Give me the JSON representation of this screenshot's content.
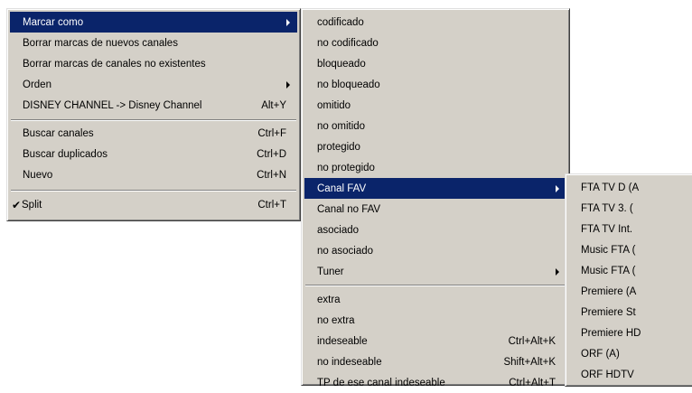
{
  "menu_main": {
    "items": [
      {
        "label": "Marcar como",
        "shortcut": ""
      },
      {
        "label": "Borrar marcas de nuevos canales",
        "shortcut": ""
      },
      {
        "label": "Borrar marcas de canales no existentes",
        "shortcut": ""
      },
      {
        "label": "Orden",
        "shortcut": ""
      },
      {
        "label": "DISNEY CHANNEL -> Disney Channel",
        "shortcut": "Alt+Y"
      },
      {
        "label": "Buscar canales",
        "shortcut": "Ctrl+F"
      },
      {
        "label": "Buscar duplicados",
        "shortcut": "Ctrl+D"
      },
      {
        "label": "Nuevo",
        "shortcut": "Ctrl+N"
      },
      {
        "label": "Split",
        "shortcut": "Ctrl+T",
        "check": "✔"
      }
    ]
  },
  "menu_marcar": {
    "items": [
      {
        "label": "codificado"
      },
      {
        "label": "no codificado"
      },
      {
        "label": "bloqueado"
      },
      {
        "label": "no bloqueado"
      },
      {
        "label": "omitido"
      },
      {
        "label": "no omitido"
      },
      {
        "label": "protegido"
      },
      {
        "label": "no protegido"
      },
      {
        "label": "Canal FAV"
      },
      {
        "label": "Canal no FAV"
      },
      {
        "label": "asociado"
      },
      {
        "label": "no asociado"
      },
      {
        "label": "Tuner"
      },
      {
        "label": "extra"
      },
      {
        "label": "no extra"
      },
      {
        "label": "indeseable",
        "shortcut": "Ctrl+Alt+K"
      },
      {
        "label": "no indeseable",
        "shortcut": "Shift+Alt+K"
      },
      {
        "label": "TP de ese canal indeseable",
        "shortcut": "Ctrl+Alt+T"
      }
    ]
  },
  "menu_fav": {
    "items": [
      {
        "label": "FTA TV D (A"
      },
      {
        "label": "FTA TV 3. ("
      },
      {
        "label": "FTA TV Int."
      },
      {
        "label": "Music FTA ("
      },
      {
        "label": "Music FTA ("
      },
      {
        "label": "Premiere (A"
      },
      {
        "label": "Premiere St"
      },
      {
        "label": "Premiere HD"
      },
      {
        "label": "ORF (A)"
      },
      {
        "label": "ORF HDTV"
      }
    ]
  }
}
